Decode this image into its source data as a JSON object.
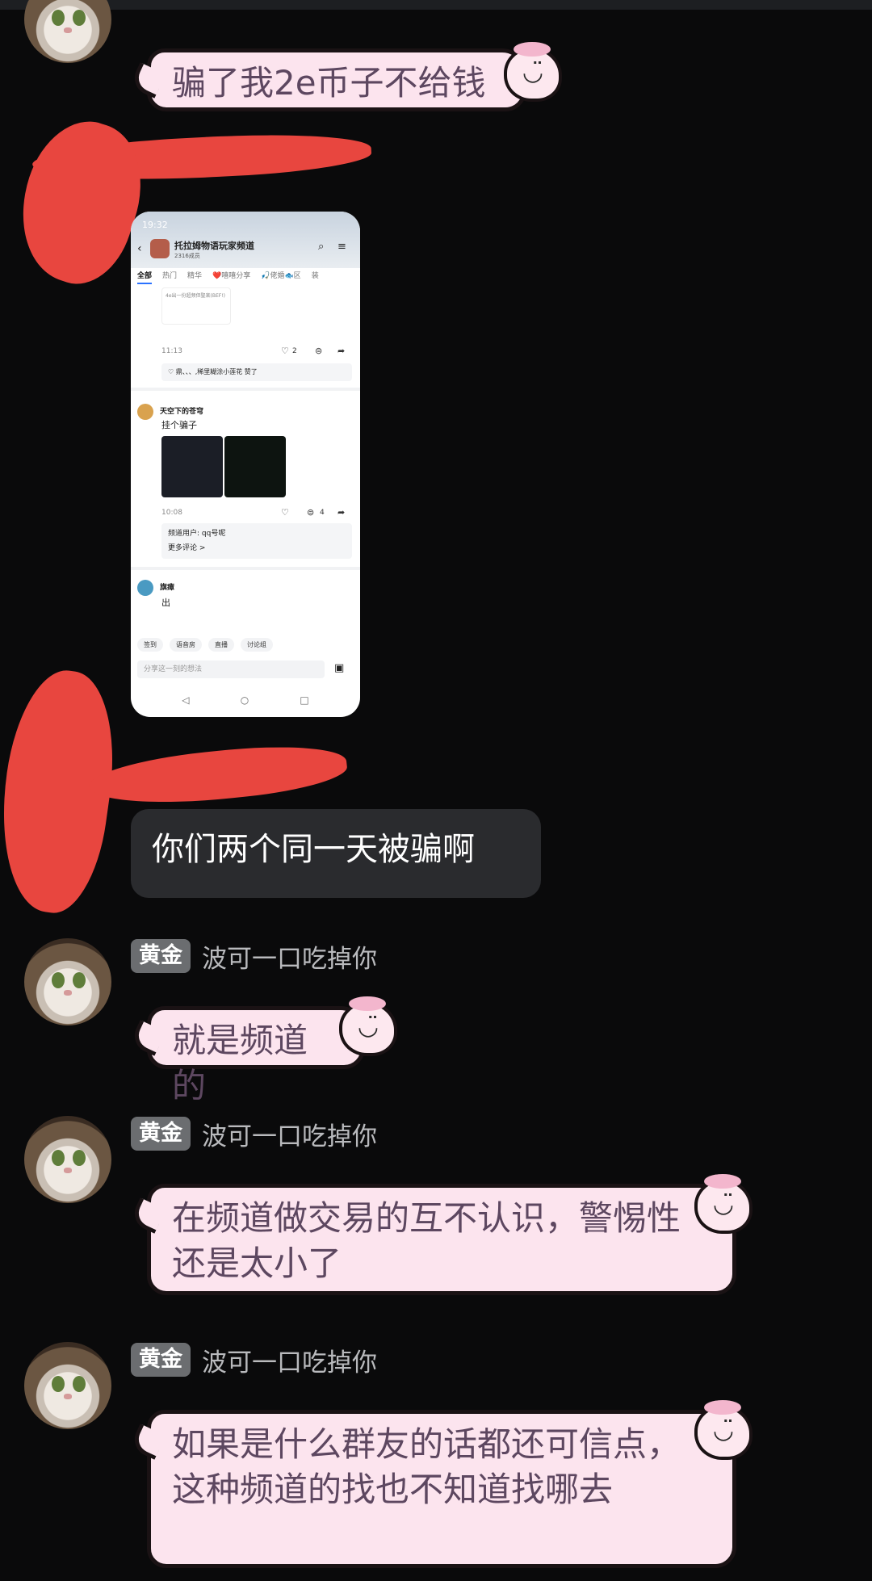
{
  "messages": {
    "m1": {
      "text": "骗了我2e币子不给钱"
    },
    "m2": {
      "text": "你们两个同一天被骗啊"
    },
    "m3": {
      "badge": "黄金",
      "nick": "波可一口吃掉你",
      "text": "就是频道的"
    },
    "m4": {
      "badge": "黄金",
      "nick": "波可一口吃掉你",
      "text": "在频道做交易的互不认识，警惕性还是太小了"
    },
    "m5": {
      "badge": "黄金",
      "nick": "波可一口吃掉你",
      "text": "如果是什么群友的话都还可信点，这种频道的找也不知道找哪去"
    }
  },
  "screenshot": {
    "time": "19:32",
    "channel_title": "托拉姆物语玩家频道",
    "channel_sub": "2316成员",
    "tabs": [
      "全部",
      "热门",
      "精华",
      "❤️嘻嘻分享",
      "🎣佬婚🐟区",
      "装"
    ],
    "post1": {
      "snippet": "4e出一份超频但聖楽(BEF!)",
      "time": "11:13",
      "likes": "2",
      "liked_by": "♡ 鼎、、、,稀里糊涂小莲花 赞了"
    },
    "post2": {
      "user": "天空下的苍穹",
      "text": "挂个骗子",
      "time": "10:08",
      "comments": "4",
      "comment_user": "频道用户: qq号呢",
      "more": "更多评论 >"
    },
    "post3": {
      "user": "旗瘴",
      "text": "出"
    },
    "toolbar": [
      "签到",
      "语音房",
      "直播",
      "讨论组"
    ],
    "input_placeholder": "分享这一刻的想法",
    "nav": [
      "◁",
      "○",
      "□"
    ]
  }
}
